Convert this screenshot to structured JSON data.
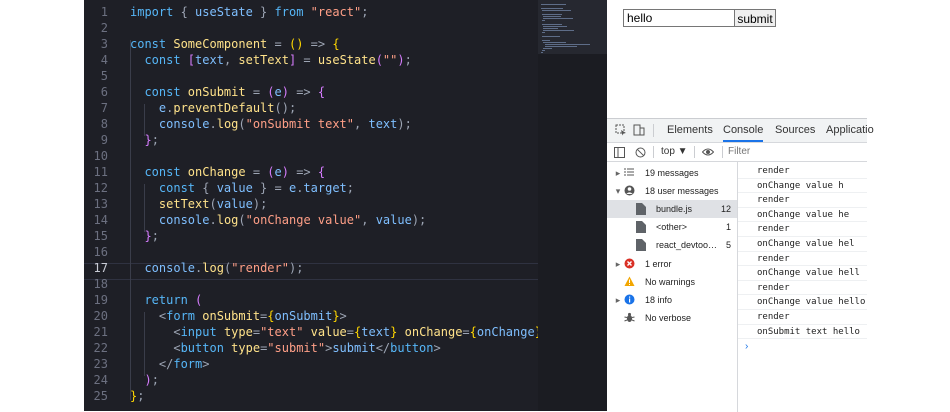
{
  "editor": {
    "line_numbers": [
      "1",
      "2",
      "3",
      "4",
      "5",
      "6",
      "7",
      "8",
      "9",
      "10",
      "11",
      "12",
      "13",
      "14",
      "15",
      "16",
      "17",
      "18",
      "19",
      "20",
      "21",
      "22",
      "23",
      "24",
      "25"
    ],
    "active_line": "17",
    "lines": [
      [
        [
          "kw",
          "import "
        ],
        [
          "pun",
          "{ "
        ],
        [
          "var",
          "useState"
        ],
        [
          "pun",
          " } "
        ],
        [
          "kw",
          "from "
        ],
        [
          "str",
          "\"react\""
        ],
        [
          "pun",
          ";"
        ]
      ],
      [],
      [
        [
          "kw",
          "const "
        ],
        [
          "fn",
          "SomeComponent"
        ],
        [
          "pun",
          " = "
        ],
        [
          "brk",
          "()"
        ],
        [
          "pun",
          " => "
        ],
        [
          "brk",
          "{"
        ]
      ],
      [
        [
          "kw",
          "  const "
        ],
        [
          "brk2",
          "["
        ],
        [
          "var",
          "text"
        ],
        [
          "pun",
          ", "
        ],
        [
          "fn",
          "setText"
        ],
        [
          "brk2",
          "]"
        ],
        [
          "pun",
          " = "
        ],
        [
          "fn",
          "useState"
        ],
        [
          "brk2",
          "("
        ],
        [
          "str",
          "\"\""
        ],
        [
          "brk2",
          ")"
        ],
        [
          "pun",
          ";"
        ]
      ],
      [],
      [
        [
          "kw",
          "  const "
        ],
        [
          "fn",
          "onSubmit"
        ],
        [
          "pun",
          " = "
        ],
        [
          "brk2",
          "("
        ],
        [
          "var",
          "e"
        ],
        [
          "brk2",
          ")"
        ],
        [
          "pun",
          " => "
        ],
        [
          "brk2",
          "{"
        ]
      ],
      [
        [
          "var",
          "    e"
        ],
        [
          "pun",
          "."
        ],
        [
          "fn",
          "preventDefault"
        ],
        [
          "pun",
          "();"
        ]
      ],
      [
        [
          "var",
          "    console"
        ],
        [
          "pun",
          "."
        ],
        [
          "fn",
          "log"
        ],
        [
          "pun",
          "("
        ],
        [
          "str",
          "\"onSubmit text\""
        ],
        [
          "pun",
          ", "
        ],
        [
          "var",
          "text"
        ],
        [
          "pun",
          ");"
        ]
      ],
      [
        [
          "brk2",
          "  }"
        ],
        [
          "pun",
          ";"
        ]
      ],
      [],
      [
        [
          "kw",
          "  const "
        ],
        [
          "fn",
          "onChange"
        ],
        [
          "pun",
          " = "
        ],
        [
          "brk2",
          "("
        ],
        [
          "var",
          "e"
        ],
        [
          "brk2",
          ")"
        ],
        [
          "pun",
          " => "
        ],
        [
          "brk2",
          "{"
        ]
      ],
      [
        [
          "kw",
          "    const "
        ],
        [
          "pun",
          "{ "
        ],
        [
          "var",
          "value"
        ],
        [
          "pun",
          " } = "
        ],
        [
          "var",
          "e"
        ],
        [
          "pun",
          "."
        ],
        [
          "var",
          "target"
        ],
        [
          "pun",
          ";"
        ]
      ],
      [
        [
          "fn",
          "    setText"
        ],
        [
          "pun",
          "("
        ],
        [
          "var",
          "value"
        ],
        [
          "pun",
          ");"
        ]
      ],
      [
        [
          "var",
          "    console"
        ],
        [
          "pun",
          "."
        ],
        [
          "fn",
          "log"
        ],
        [
          "pun",
          "("
        ],
        [
          "str",
          "\"onChange value\""
        ],
        [
          "pun",
          ", "
        ],
        [
          "var",
          "value"
        ],
        [
          "pun",
          ");"
        ]
      ],
      [
        [
          "brk2",
          "  }"
        ],
        [
          "pun",
          ";"
        ]
      ],
      [],
      [
        [
          "var",
          "  console"
        ],
        [
          "pun",
          "."
        ],
        [
          "fn",
          "log"
        ],
        [
          "pun",
          "("
        ],
        [
          "str",
          "\"render\""
        ],
        [
          "pun",
          ");"
        ]
      ],
      [],
      [
        [
          "kw",
          "  return "
        ],
        [
          "brk2",
          "("
        ]
      ],
      [
        [
          "pun",
          "    <"
        ],
        [
          "tag",
          "form "
        ],
        [
          "attr",
          "onSubmit"
        ],
        [
          "pun",
          "="
        ],
        [
          "brk",
          "{"
        ],
        [
          "var",
          "onSubmit"
        ],
        [
          "brk",
          "}"
        ],
        [
          "pun",
          ">"
        ]
      ],
      [
        [
          "pun",
          "      <"
        ],
        [
          "tag",
          "input "
        ],
        [
          "attr",
          "type"
        ],
        [
          "pun",
          "="
        ],
        [
          "str",
          "\"text\" "
        ],
        [
          "attr",
          "value"
        ],
        [
          "pun",
          "="
        ],
        [
          "brk",
          "{"
        ],
        [
          "var",
          "text"
        ],
        [
          "brk",
          "}"
        ],
        [
          "attr",
          " onChange"
        ],
        [
          "pun",
          "="
        ],
        [
          "brk",
          "{"
        ],
        [
          "var",
          "onChange"
        ],
        [
          "brk",
          "}"
        ],
        [
          "pun",
          " />"
        ]
      ],
      [
        [
          "pun",
          "      <"
        ],
        [
          "tag",
          "button "
        ],
        [
          "attr",
          "type"
        ],
        [
          "pun",
          "="
        ],
        [
          "str",
          "\"submit\""
        ],
        [
          "pun",
          ">"
        ],
        [
          "var",
          "submit"
        ],
        [
          "pun",
          "</"
        ],
        [
          "tag",
          "button"
        ],
        [
          "pun",
          ">"
        ]
      ],
      [
        [
          "pun",
          "    </"
        ],
        [
          "tag",
          "form"
        ],
        [
          "pun",
          ">"
        ]
      ],
      [
        [
          "brk2",
          "  )"
        ],
        [
          "pun",
          ";"
        ]
      ],
      [
        [
          "brk",
          "}"
        ],
        [
          "pun",
          ";"
        ]
      ]
    ]
  },
  "colors": {
    "editor_bg": "#1e1f26",
    "accent": "#1a73e8"
  },
  "page": {
    "input_value": "hello",
    "submit_label": "submit"
  },
  "devtools": {
    "tabs": [
      "Elements",
      "Console",
      "Sources",
      "Applicatio"
    ],
    "active_tab": "Console",
    "toolbar": {
      "context": "top ▼",
      "filter_placeholder": "Filter"
    },
    "sidebar": [
      {
        "icon": "list-icon",
        "label": "19 messages",
        "count": ""
      },
      {
        "icon": "user-icon",
        "label": "18 user messages",
        "count": ""
      },
      {
        "icon": "file-icon",
        "label": "bundle.js",
        "count": "12"
      },
      {
        "icon": "file-icon",
        "label": "<other>",
        "count": "1"
      },
      {
        "icon": "file-icon",
        "label": "react_devtoo…",
        "count": "5"
      },
      {
        "icon": "error-icon",
        "label": "1 error",
        "count": ""
      },
      {
        "icon": "warning-icon",
        "label": "No warnings",
        "count": ""
      },
      {
        "icon": "info-icon",
        "label": "18 info",
        "count": ""
      },
      {
        "icon": "bug-icon",
        "label": "No verbose",
        "count": ""
      }
    ],
    "messages": [
      "render",
      "onChange value h",
      "render",
      "onChange value he",
      "render",
      "onChange value hel",
      "render",
      "onChange value hell",
      "render",
      "onChange value hello",
      "render",
      "onSubmit text hello"
    ],
    "prompt": "›"
  }
}
